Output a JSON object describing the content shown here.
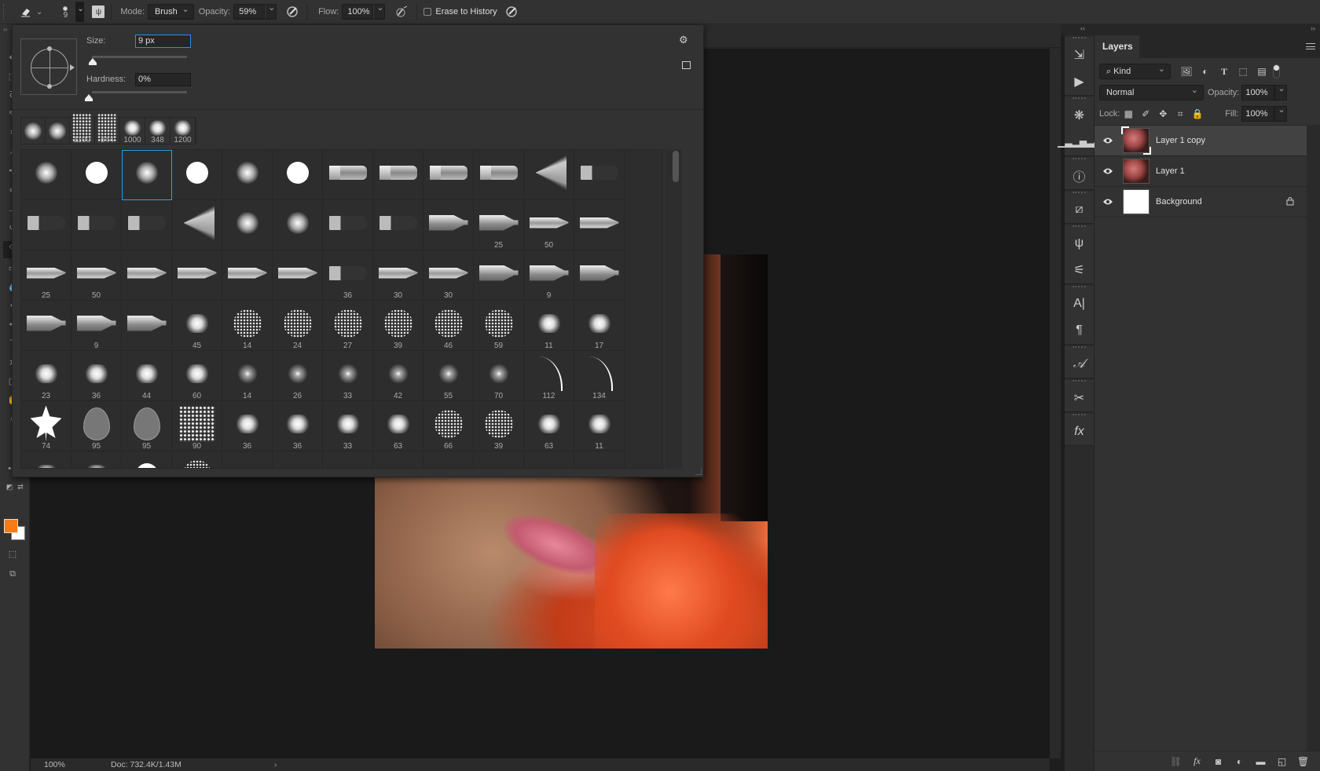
{
  "options_bar": {
    "tool_icon": "eraser-icon",
    "brush_size": "9",
    "mode_label": "Mode:",
    "mode_value": "Brush",
    "opacity_label": "Opacity:",
    "opacity_value": "59%",
    "flow_label": "Flow:",
    "flow_value": "100%",
    "erase_history_label": "Erase to History",
    "erase_history_checked": false
  },
  "brush_picker": {
    "size_label": "Size:",
    "size_value": "9 px",
    "size_fraction": 0.0,
    "hardness_label": "Hardness:",
    "hardness_value": "0%",
    "hardness_fraction": 0.0,
    "recent_brushes": [
      {
        "kind": "soft",
        "label": ""
      },
      {
        "kind": "soft",
        "label": ""
      },
      {
        "kind": "texture",
        "label": "1100"
      },
      {
        "kind": "texture",
        "label": "544"
      },
      {
        "kind": "splat",
        "label": "1000"
      },
      {
        "kind": "splat",
        "label": "348"
      },
      {
        "kind": "splat",
        "label": "1200"
      }
    ],
    "selected_index": 2,
    "presets": [
      {
        "kind": "soft",
        "label": ""
      },
      {
        "kind": "hard",
        "label": ""
      },
      {
        "kind": "soft",
        "label": ""
      },
      {
        "kind": "hard",
        "label": ""
      },
      {
        "kind": "soft",
        "label": ""
      },
      {
        "kind": "hard",
        "label": ""
      },
      {
        "kind": "flat",
        "label": ""
      },
      {
        "kind": "flat",
        "label": ""
      },
      {
        "kind": "flat",
        "label": ""
      },
      {
        "kind": "flat",
        "label": ""
      },
      {
        "kind": "fan",
        "label": ""
      },
      {
        "kind": "bristle",
        "label": ""
      },
      {
        "kind": "bristle",
        "label": ""
      },
      {
        "kind": "bristle",
        "label": ""
      },
      {
        "kind": "bristle",
        "label": ""
      },
      {
        "kind": "fan",
        "label": ""
      },
      {
        "kind": "soft",
        "label": ""
      },
      {
        "kind": "soft",
        "label": ""
      },
      {
        "kind": "bristle",
        "label": ""
      },
      {
        "kind": "bristle",
        "label": ""
      },
      {
        "kind": "pencil",
        "label": ""
      },
      {
        "kind": "pencil",
        "label": "25"
      },
      {
        "kind": "marker",
        "label": "50"
      },
      {
        "kind": "marker",
        "label": ""
      },
      {
        "kind": "marker",
        "label": "25"
      },
      {
        "kind": "marker",
        "label": "50"
      },
      {
        "kind": "marker",
        "label": ""
      },
      {
        "kind": "marker",
        "label": ""
      },
      {
        "kind": "marker",
        "label": ""
      },
      {
        "kind": "marker",
        "label": ""
      },
      {
        "kind": "bristle",
        "label": "36"
      },
      {
        "kind": "marker",
        "label": "30"
      },
      {
        "kind": "marker",
        "label": "30"
      },
      {
        "kind": "pencil",
        "label": ""
      },
      {
        "kind": "pencil",
        "label": "9"
      },
      {
        "kind": "pencil",
        "label": ""
      },
      {
        "kind": "pencil",
        "label": ""
      },
      {
        "kind": "pencil",
        "label": "9"
      },
      {
        "kind": "pencil",
        "label": ""
      },
      {
        "kind": "splat",
        "label": "45"
      },
      {
        "kind": "speck",
        "label": "14"
      },
      {
        "kind": "speck",
        "label": "24"
      },
      {
        "kind": "speck",
        "label": "27"
      },
      {
        "kind": "speck",
        "label": "39"
      },
      {
        "kind": "speck",
        "label": "46"
      },
      {
        "kind": "speck",
        "label": "59"
      },
      {
        "kind": "splat",
        "label": "11"
      },
      {
        "kind": "splat",
        "label": "17"
      },
      {
        "kind": "splat",
        "label": "23"
      },
      {
        "kind": "splat",
        "label": "36"
      },
      {
        "kind": "splat",
        "label": "44"
      },
      {
        "kind": "splat",
        "label": "60"
      },
      {
        "kind": "star",
        "label": "14"
      },
      {
        "kind": "star",
        "label": "26"
      },
      {
        "kind": "star",
        "label": "33"
      },
      {
        "kind": "star",
        "label": "42"
      },
      {
        "kind": "star",
        "label": "55"
      },
      {
        "kind": "star",
        "label": "70"
      },
      {
        "kind": "grass",
        "label": "112"
      },
      {
        "kind": "grass",
        "label": "134"
      },
      {
        "kind": "leaf",
        "label": "74"
      },
      {
        "kind": "leaf-outline",
        "label": "95"
      },
      {
        "kind": "leaf-outline",
        "label": "95"
      },
      {
        "kind": "texture",
        "label": "90"
      },
      {
        "kind": "splat",
        "label": "36"
      },
      {
        "kind": "splat",
        "label": "36"
      },
      {
        "kind": "splat",
        "label": "33"
      },
      {
        "kind": "splat",
        "label": "63"
      },
      {
        "kind": "speck",
        "label": "66"
      },
      {
        "kind": "speck",
        "label": "39"
      },
      {
        "kind": "splat",
        "label": "63"
      },
      {
        "kind": "splat",
        "label": "11"
      },
      {
        "kind": "splat",
        "label": ""
      },
      {
        "kind": "splat",
        "label": ""
      },
      {
        "kind": "hard",
        "label": ""
      },
      {
        "kind": "speck",
        "label": ""
      },
      {
        "kind": "arc",
        "label": ""
      },
      {
        "kind": "arc",
        "label": ""
      },
      {
        "kind": "arc",
        "label": ""
      },
      {
        "kind": "arc",
        "label": ""
      },
      {
        "kind": "arc-thick",
        "label": ""
      },
      {
        "kind": "arc-double",
        "label": ""
      },
      {
        "kind": "arc-double",
        "label": ""
      },
      {
        "kind": "arc-double",
        "label": ""
      }
    ]
  },
  "status_bar": {
    "zoom": "100%",
    "doc_info": "Doc: 732.4K/1.43M",
    "arrow": "›"
  },
  "colors": {
    "foreground": "#f47b16",
    "background": "#ffffff",
    "selection_accent": "#2aa3df"
  },
  "layers_panel": {
    "title": "Layers",
    "filter_kind": "Kind",
    "blend_mode": "Normal",
    "opacity_label": "Opacity:",
    "opacity_value": "100%",
    "lock_label": "Lock:",
    "fill_label": "Fill:",
    "fill_value": "100%",
    "layers": [
      {
        "name": "Layer 1 copy",
        "visible": true,
        "active": true,
        "thumb": "photo",
        "locked": false
      },
      {
        "name": "Layer 1",
        "visible": true,
        "active": false,
        "thumb": "photo",
        "locked": false
      },
      {
        "name": "Background",
        "visible": true,
        "active": false,
        "thumb": "white",
        "locked": true
      }
    ]
  },
  "glyphs": {
    "chevron": "⌄",
    "eye": "👁",
    "lock": "🔒",
    "gear": "⚙",
    "search": "⌕"
  }
}
